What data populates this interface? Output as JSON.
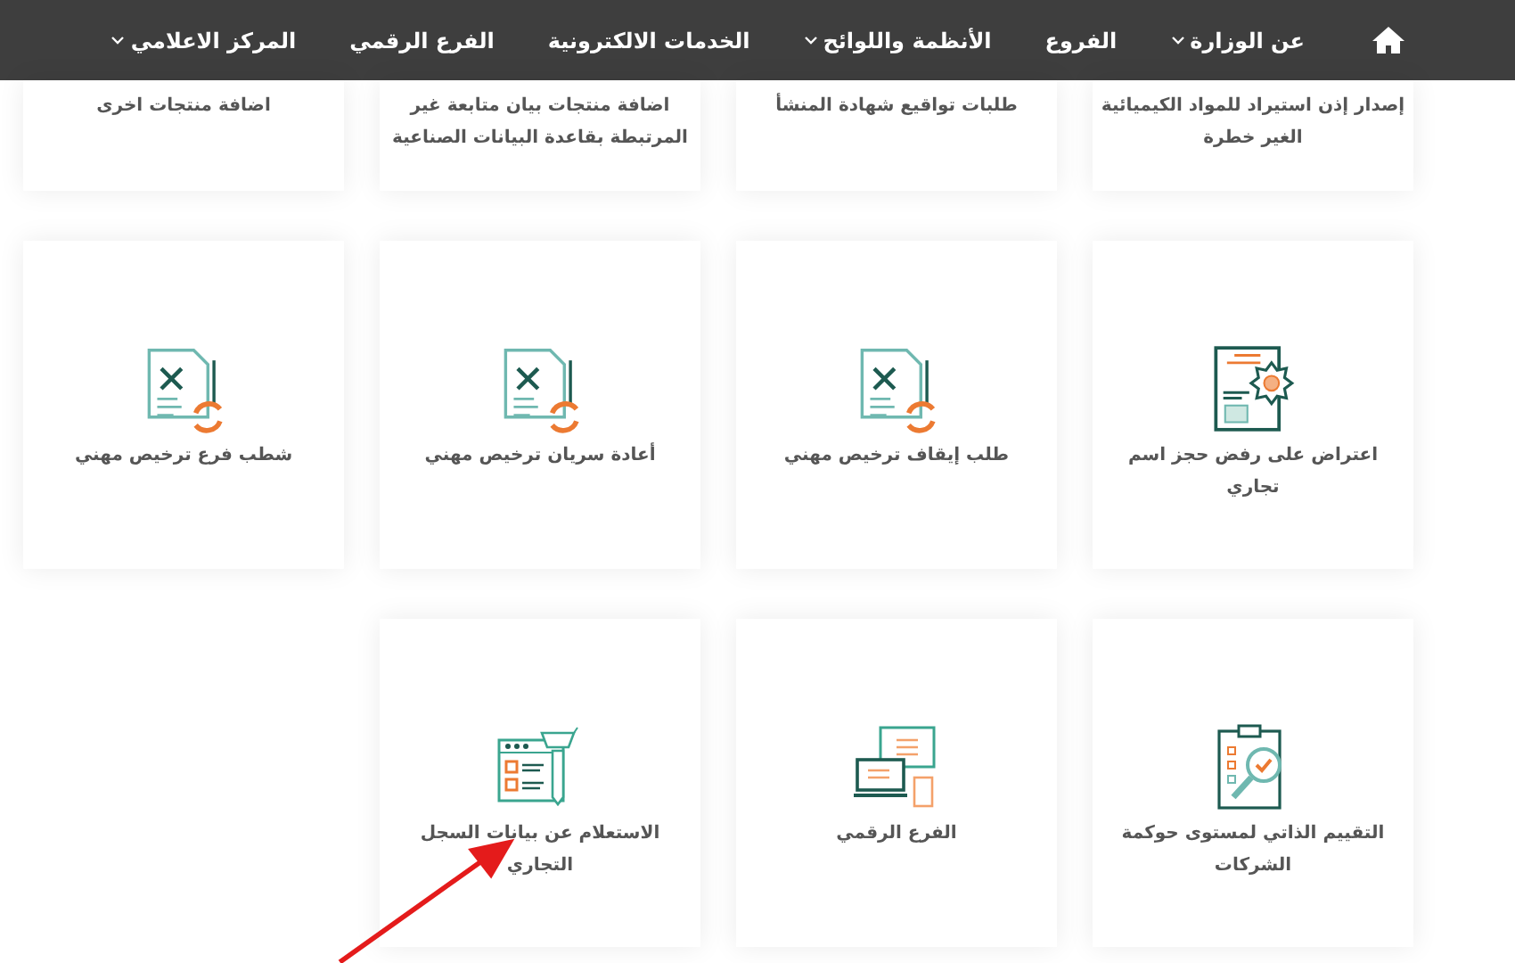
{
  "nav": {
    "items": [
      {
        "kind": "home"
      },
      {
        "kind": "link",
        "label": "عن الوزارة",
        "dropdown": true
      },
      {
        "kind": "link",
        "label": "الفروع",
        "dropdown": false
      },
      {
        "kind": "link",
        "label": "الأنظمة واللوائح",
        "dropdown": true
      },
      {
        "kind": "link",
        "label": "الخدمات الالكترونية",
        "dropdown": false
      },
      {
        "kind": "link",
        "label": "الفرع الرقمي",
        "dropdown": false
      },
      {
        "kind": "link",
        "label": "المركز الاعلامي",
        "dropdown": true
      }
    ]
  },
  "services": [
    {
      "title": "إصدار إذن استيراد للمواد الكيميائية الغير خطرة"
    },
    {
      "title": "طلبات تواقيع شهادة المنشأ"
    },
    {
      "title": "اضافة منتجات بيان متابعة غير المرتبطة بقاعدة البيانات الصناعية"
    },
    {
      "title": "اضافة منتجات اخرى"
    },
    {
      "title": "اعتراض على رفض حجز اسم تجاري",
      "kind": "certificate"
    },
    {
      "title": "طلب إيقاف ترخيص مهني",
      "kind": "license"
    },
    {
      "title": "أعادة سريان ترخيص مهني",
      "kind": "license"
    },
    {
      "title": "شطب فرع ترخيص مهني",
      "kind": "license"
    },
    {
      "title": "التقييم الذاتي لمستوى حوكمة الشركات",
      "kind": "assessment"
    },
    {
      "title": "الفرع الرقمي",
      "kind": "devices"
    },
    {
      "title": "الاستعلام عن بيانات السجل التجاري",
      "kind": "inquiry"
    }
  ]
}
